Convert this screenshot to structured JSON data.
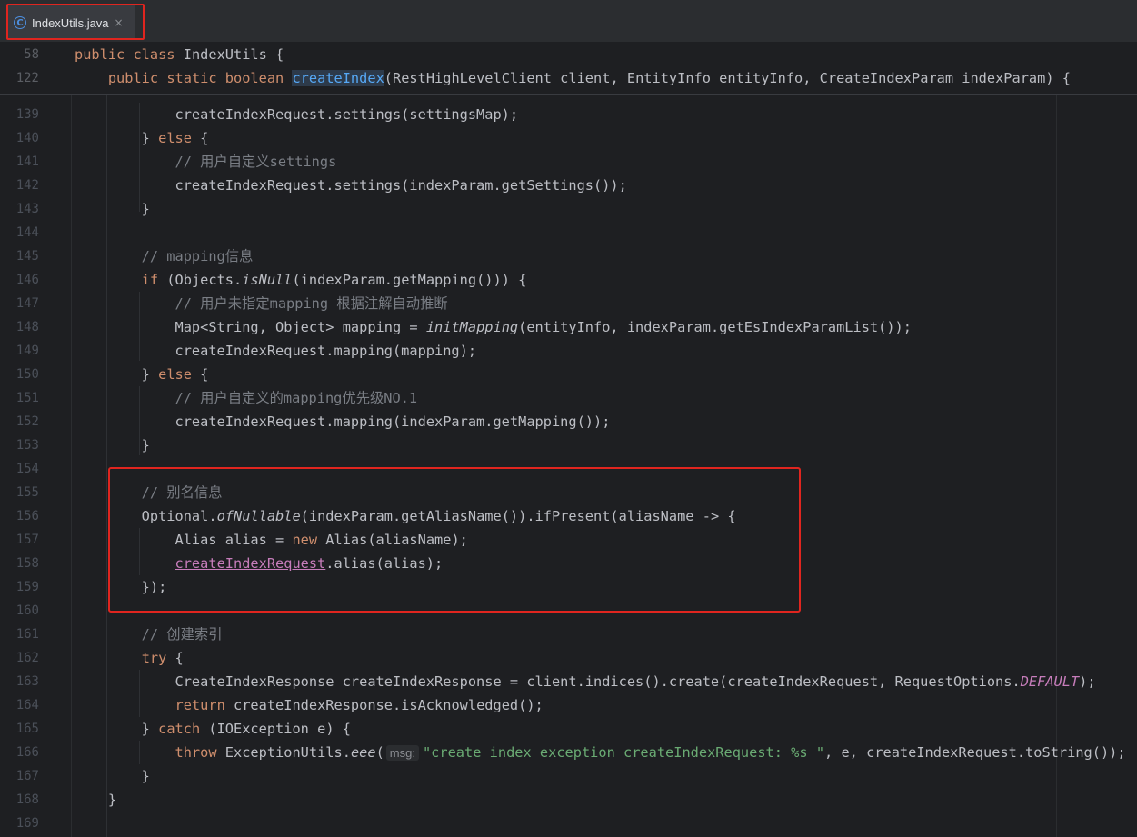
{
  "tab": {
    "filename": "IndexUtils.java",
    "file_type_icon": "C",
    "close_label": "×"
  },
  "sticky": [
    {
      "num": "58",
      "parts": [
        [
          "kw",
          "public "
        ],
        [
          "kw",
          "class "
        ],
        [
          "",
          "IndexUtils {"
        ]
      ]
    },
    {
      "num": "122",
      "parts": [
        [
          "",
          "    "
        ],
        [
          "kw",
          "public "
        ],
        [
          "kw",
          "static "
        ],
        [
          "kw",
          "boolean "
        ],
        [
          "fn-decl hl-decl",
          "createIndex"
        ],
        [
          "",
          "(RestHighLevelClient client, EntityInfo entityInfo, CreateIndexParam indexParam) {"
        ]
      ]
    }
  ],
  "lines": [
    {
      "num": "139",
      "parts": [
        [
          "",
          "            createIndexRequest.settings(settingsMap);"
        ]
      ]
    },
    {
      "num": "140",
      "parts": [
        [
          "",
          "        } "
        ],
        [
          "kw",
          "else"
        ],
        [
          "",
          " {"
        ]
      ]
    },
    {
      "num": "141",
      "parts": [
        [
          "cm",
          "            // 用户自定义settings"
        ]
      ]
    },
    {
      "num": "142",
      "parts": [
        [
          "",
          "            createIndexRequest.settings(indexParam.getSettings());"
        ]
      ]
    },
    {
      "num": "143",
      "parts": [
        [
          "",
          "        }"
        ]
      ]
    },
    {
      "num": "144",
      "parts": [
        [
          "",
          ""
        ]
      ]
    },
    {
      "num": "145",
      "parts": [
        [
          "cm",
          "        // mapping信息"
        ]
      ]
    },
    {
      "num": "146",
      "parts": [
        [
          "",
          "        "
        ],
        [
          "kw",
          "if"
        ],
        [
          "",
          " (Objects."
        ],
        [
          "mth-static",
          "isNull"
        ],
        [
          "",
          "(indexParam.getMapping())) {"
        ]
      ]
    },
    {
      "num": "147",
      "parts": [
        [
          "cm",
          "            // 用户未指定mapping 根据注解自动推断"
        ]
      ]
    },
    {
      "num": "148",
      "parts": [
        [
          "",
          "            Map<String, Object> mapping = "
        ],
        [
          "mth-static",
          "initMapping"
        ],
        [
          "",
          "(entityInfo, indexParam.getEsIndexParamList());"
        ]
      ]
    },
    {
      "num": "149",
      "parts": [
        [
          "",
          "            createIndexRequest.mapping(mapping);"
        ]
      ]
    },
    {
      "num": "150",
      "parts": [
        [
          "",
          "        } "
        ],
        [
          "kw",
          "else"
        ],
        [
          "",
          " {"
        ]
      ]
    },
    {
      "num": "151",
      "parts": [
        [
          "cm",
          "            // 用户自定义的mapping优先级NO.1"
        ]
      ]
    },
    {
      "num": "152",
      "parts": [
        [
          "",
          "            createIndexRequest.mapping(indexParam.getMapping());"
        ]
      ]
    },
    {
      "num": "153",
      "parts": [
        [
          "",
          "        }"
        ]
      ]
    },
    {
      "num": "154",
      "parts": [
        [
          "",
          ""
        ]
      ]
    },
    {
      "num": "155",
      "parts": [
        [
          "cm",
          "        // 别名信息"
        ]
      ]
    },
    {
      "num": "156",
      "parts": [
        [
          "",
          "        Optional."
        ],
        [
          "mth-static",
          "ofNullable"
        ],
        [
          "",
          "(indexParam.getAliasName()).ifPresent(aliasName -> {"
        ]
      ]
    },
    {
      "num": "157",
      "parts": [
        [
          "",
          "            Alias alias = "
        ],
        [
          "kw",
          "new"
        ],
        [
          "",
          " Alias(aliasName);"
        ]
      ]
    },
    {
      "num": "158",
      "parts": [
        [
          "",
          "            "
        ],
        [
          "ul-var",
          "createIndexRequest"
        ],
        [
          "",
          ".alias(alias);"
        ]
      ]
    },
    {
      "num": "159",
      "parts": [
        [
          "",
          "        });"
        ]
      ]
    },
    {
      "num": "160",
      "parts": [
        [
          "",
          ""
        ]
      ]
    },
    {
      "num": "161",
      "parts": [
        [
          "cm",
          "        // 创建索引"
        ]
      ]
    },
    {
      "num": "162",
      "parts": [
        [
          "",
          "        "
        ],
        [
          "kw",
          "try"
        ],
        [
          "",
          " {"
        ]
      ]
    },
    {
      "num": "163",
      "parts": [
        [
          "",
          "            CreateIndexResponse createIndexResponse = client.indices().create(createIndexRequest, RequestOptions."
        ],
        [
          "const",
          "DEFAULT"
        ],
        [
          "",
          ");"
        ]
      ]
    },
    {
      "num": "164",
      "parts": [
        [
          "",
          "            "
        ],
        [
          "kw",
          "return"
        ],
        [
          "",
          " createIndexResponse.isAcknowledged();"
        ]
      ]
    },
    {
      "num": "165",
      "parts": [
        [
          "",
          "        } "
        ],
        [
          "kw",
          "catch"
        ],
        [
          "",
          " (IOException e) {"
        ]
      ]
    },
    {
      "num": "166",
      "parts": [
        [
          "",
          "            "
        ],
        [
          "kw",
          "throw"
        ],
        [
          "",
          " ExceptionUtils."
        ],
        [
          "mth-static",
          "eee"
        ],
        [
          "",
          "("
        ],
        [
          "hint",
          "msg:"
        ],
        [
          "str",
          "\"create index exception createIndexRequest: %s \""
        ],
        [
          "",
          ", e, createIndexRequest.toString());"
        ]
      ]
    },
    {
      "num": "167",
      "parts": [
        [
          "",
          "        }"
        ]
      ]
    },
    {
      "num": "168",
      "parts": [
        [
          "",
          "    }"
        ]
      ]
    },
    {
      "num": "169",
      "parts": [
        [
          "",
          ""
        ]
      ]
    }
  ]
}
